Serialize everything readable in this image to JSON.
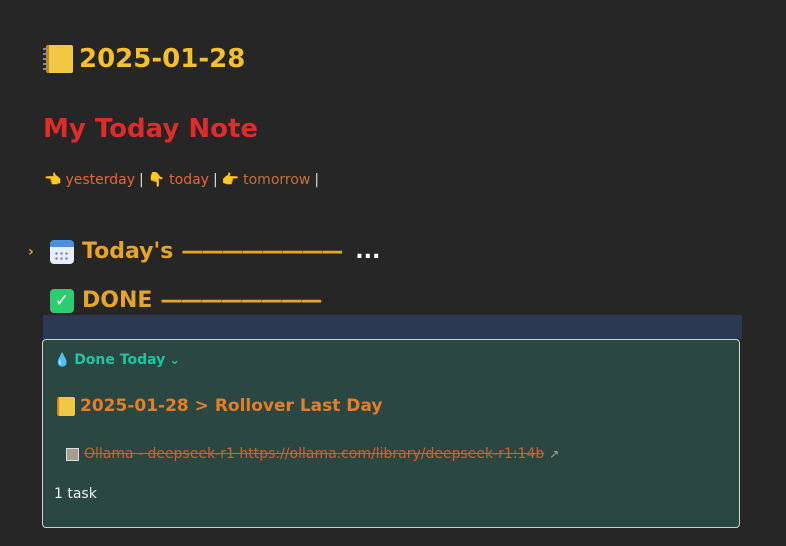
{
  "note": {
    "date_title": "2025-01-28",
    "main_heading": "My Today Note"
  },
  "nav": {
    "yesterday_icon": "👈",
    "yesterday": "yesterday",
    "today_icon": "👇",
    "today": "today",
    "tomorrow_icon": "👉",
    "tomorrow": "tomorrow",
    "separator": "|"
  },
  "sections": {
    "todays_label": "Today's",
    "todays_rule": "————————",
    "todays_more": "...",
    "done_label": "DONE",
    "done_rule": "————————"
  },
  "query": {
    "header": "Done Today",
    "header_icon": "💧",
    "group_title": "2025-01-28 > Rollover Last Day",
    "task_text": "Ollama - deepseek-r1 https://ollama.com/library/deepseek-r1:14b",
    "count_text": "1 task"
  },
  "icons": {
    "title": "notebook-icon",
    "todays": "calendar-icon",
    "done": "check-box-icon",
    "chevron": "chevron-right-icon",
    "header_chevron": "chevron-down-icon",
    "external": "external-link-icon"
  },
  "colors": {
    "background": "#262626",
    "title": "#f5c02a",
    "heading": "#e02b2b",
    "section": "#e6a429",
    "query_bg": "#2b4742",
    "accent_teal": "#1fc6a2"
  }
}
